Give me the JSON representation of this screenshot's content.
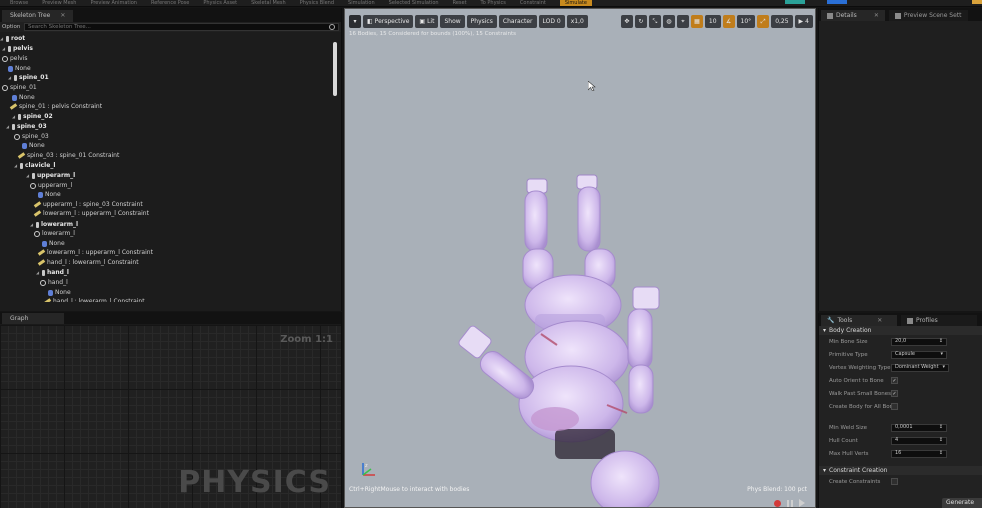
{
  "topbar": {
    "items": [
      "Browse",
      "Preview Mesh",
      "Preview Animation",
      "Reference Pose",
      "Physics Asset",
      "Skeletal Mesh",
      "Physics Blend",
      "Simulation",
      "Selected Simulation",
      "Reset",
      "To Physics",
      "Constraint"
    ],
    "active": "Simulate"
  },
  "skeleton_tree": {
    "tab_label": "Skeleton Tree",
    "options_label": "Options",
    "search_placeholder": "Search Skeleton Tree...",
    "rows": [
      {
        "label": "root",
        "type": "bone",
        "bold": true
      },
      {
        "label": "pelvis",
        "type": "bone",
        "bold": true
      },
      {
        "label": "pelvis",
        "type": "body",
        "bold": false
      },
      {
        "label": "None",
        "type": "shape",
        "bold": false
      },
      {
        "label": "spine_01",
        "type": "bone",
        "bold": true
      },
      {
        "label": "spine_01",
        "type": "body",
        "bold": false
      },
      {
        "label": "None",
        "type": "shape",
        "bold": false
      },
      {
        "label": "spine_01 : pelvis Constraint",
        "type": "constraint",
        "bold": false
      },
      {
        "label": "spine_02",
        "type": "bone",
        "bold": true
      },
      {
        "label": "spine_03",
        "type": "bone",
        "bold": true
      },
      {
        "label": "spine_03",
        "type": "body",
        "bold": false
      },
      {
        "label": "None",
        "type": "shape",
        "bold": false
      },
      {
        "label": "spine_03 : spine_01 Constraint",
        "type": "constraint",
        "bold": false
      },
      {
        "label": "clavicle_l",
        "type": "bone",
        "bold": true
      },
      {
        "label": "upperarm_l",
        "type": "bone",
        "bold": true
      },
      {
        "label": "upperarm_l",
        "type": "body",
        "bold": false
      },
      {
        "label": "None",
        "type": "shape",
        "bold": false
      },
      {
        "label": "upperarm_l : spine_03 Constraint",
        "type": "constraint",
        "bold": false
      },
      {
        "label": "lowerarm_l : upperarm_l Constraint",
        "type": "constraint",
        "bold": false
      },
      {
        "label": "lowerarm_l",
        "type": "bone",
        "bold": true
      },
      {
        "label": "lowerarm_l",
        "type": "body",
        "bold": false
      },
      {
        "label": "None",
        "type": "shape",
        "bold": false
      },
      {
        "label": "lowerarm_l : upperarm_l Constraint",
        "type": "constraint",
        "bold": false
      },
      {
        "label": "hand_l : lowerarm_l Constraint",
        "type": "constraint",
        "bold": false
      },
      {
        "label": "hand_l",
        "type": "bone",
        "bold": true
      },
      {
        "label": "hand_l",
        "type": "body",
        "bold": false
      },
      {
        "label": "None",
        "type": "shape",
        "bold": false
      },
      {
        "label": "hand_l : lowerarm_l Constraint",
        "type": "constraint",
        "bold": false
      }
    ]
  },
  "graph": {
    "tab_label": "Graph",
    "zoom_label": "Zoom 1:1",
    "watermark": "PHYSICS"
  },
  "viewport": {
    "toolbar": {
      "perspective": "Perspective",
      "lit": "Lit",
      "show": "Show",
      "physics": "Physics",
      "character": "Character",
      "lod": "LOD 0",
      "speed": "x1,0",
      "grid_snap": "10",
      "rot_snap": "10°",
      "scale_snap": "0,25",
      "cam_speed": "4"
    },
    "stats": "16 Bodies, 15 Considered for bounds (100%), 15 Constraints",
    "hint": "Ctrl+RightMouse to interact with bodies",
    "blend": "Phys Blend: 100 pct"
  },
  "details": {
    "tab_label": "Details",
    "tab2_label": "Preview Scene Sett"
  },
  "tools": {
    "tab_label": "Tools",
    "tab2_label": "Profiles",
    "body_creation": "Body Creation",
    "props": {
      "min_bone_size_label": "Min Bone Size",
      "min_bone_size": "20,0",
      "primitive_type_label": "Primitive Type",
      "primitive_type": "Capsule",
      "vertex_weighting_label": "Vertex Weighting Type",
      "vertex_weighting": "Dominant Weight",
      "auto_orient_label": "Auto Orient to Bone",
      "auto_orient": true,
      "walk_past_label": "Walk Past Small Bones",
      "walk_past": true,
      "create_all_label": "Create Body for All Bones",
      "create_all": false,
      "min_weld_label": "Min Weld Size",
      "min_weld": "0,0001",
      "hull_count_label": "Hull Count",
      "hull_count": "4",
      "max_hull_label": "Max Hull Verts",
      "max_hull": "16"
    },
    "constraint_creation": "Constraint Creation",
    "create_constraints_label": "Create Constraints",
    "generate_label": "Generate"
  },
  "colors": {
    "viewport_bg": "#a9b0b8",
    "body_fill": "#d9c7ef",
    "accent": "#c07d1b"
  }
}
